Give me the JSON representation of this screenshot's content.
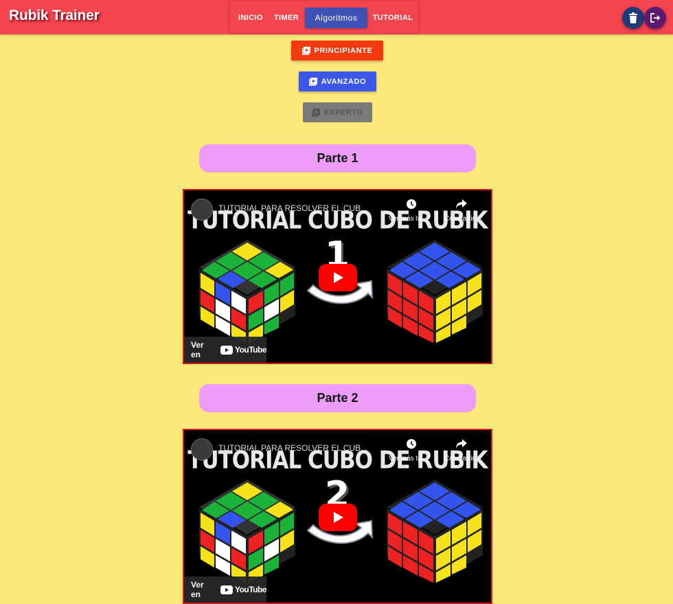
{
  "app": {
    "title": "Rubik Trainer"
  },
  "nav": {
    "items": [
      {
        "label": "INICIO",
        "active": false
      },
      {
        "label": "TIMER",
        "active": false
      },
      {
        "label": "Algoritmos",
        "active": true
      },
      {
        "label": "TUTORIAL",
        "active": false
      }
    ]
  },
  "header_actions": {
    "delete_icon": "trash-icon",
    "logout_icon": "logout-icon",
    "delete_color": "#1e3a78",
    "logout_color": "#5b1a6e"
  },
  "levels": [
    {
      "label": "PRINCIPIANTE",
      "color": "#f23a0e",
      "disabled": false
    },
    {
      "label": "AVANZADO",
      "color": "#3b57e8",
      "disabled": false
    },
    {
      "label": "EXPERTO",
      "color": "#7a7a7a",
      "disabled": true
    }
  ],
  "parts": [
    {
      "heading": "Parte 1",
      "video": {
        "channel_title": "TUTORIAL PARA RESOLVER EL CUB...",
        "overlay_title": "TUTORIAL CUBO DE RUBIK",
        "overlay_number": "1",
        "watch_later": "Ver más ta...",
        "share": "Compartir",
        "watch_on": "Ver en",
        "platform": "YouTube"
      }
    },
    {
      "heading": "Parte 2",
      "video": {
        "channel_title": "TUTORIAL PARA RESOLVER EL CUB...",
        "overlay_title": "TUTORIAL CUBO DE RUBIK",
        "overlay_number": "2",
        "watch_later": "Ver más ta...",
        "share": "Compartir",
        "watch_on": "Ver en",
        "platform": "YouTube"
      }
    }
  ],
  "colors": {
    "header": "#f4444e",
    "page_background": "#fde87a",
    "part_heading": "#ee9cf9",
    "nav_active": "#3f51b5",
    "video_border": "#d81b1b"
  }
}
